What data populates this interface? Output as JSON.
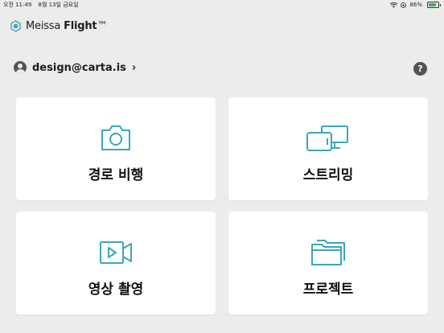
{
  "status_bar": {
    "time": "오전 11:49",
    "date": "8월 13일 금요일",
    "battery": "86%",
    "battery_level": 0.86
  },
  "app": {
    "logo_regular": "Meissa ",
    "logo_bold": "Flight",
    "logo_tm": "™",
    "accent_color": "#3aa7b7"
  },
  "account": {
    "email": "design@carta.is",
    "chevron": "›"
  },
  "help": {
    "label": "?"
  },
  "cards": [
    {
      "label": "경로 비행",
      "icon": "camera-icon"
    },
    {
      "label": "스트리밍",
      "icon": "monitor-tablet-icon"
    },
    {
      "label": "영상 촬영",
      "icon": "video-icon"
    },
    {
      "label": "프로젝트",
      "icon": "folder-icon"
    }
  ]
}
